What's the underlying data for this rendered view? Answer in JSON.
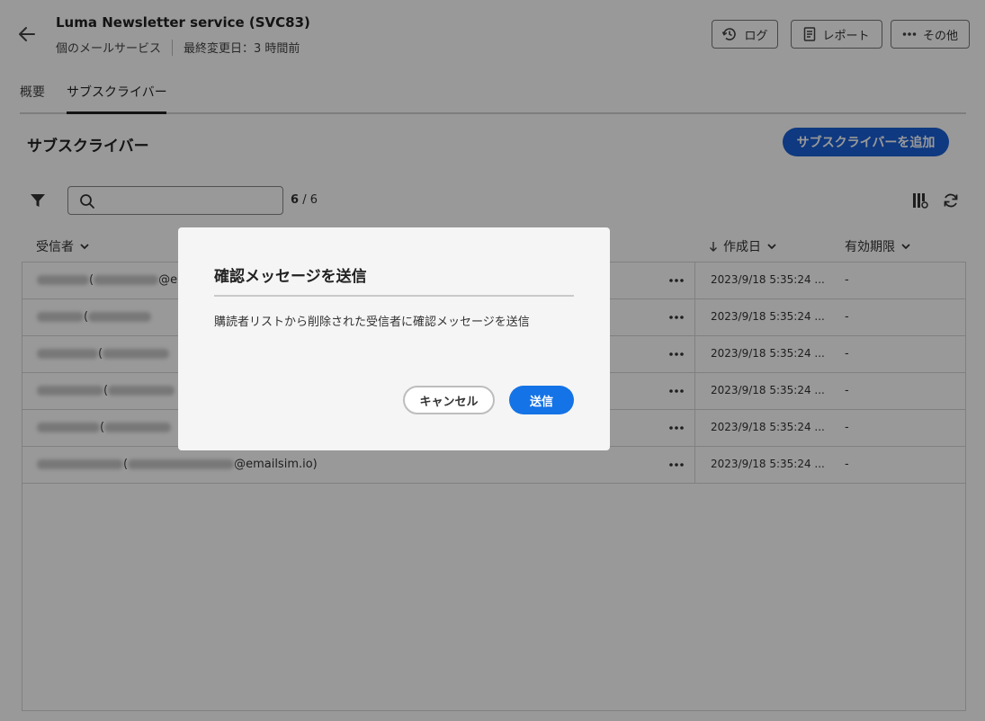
{
  "header": {
    "title": "Luma Newsletter service (SVC83)",
    "service_type": "個のメールサービス",
    "last_modified": "最終変更日：3 時間前",
    "log_label": "ログ",
    "report_label": "レポート",
    "more_label": "その他"
  },
  "tabs": [
    {
      "label": "概要"
    },
    {
      "label": "サブスクライバー"
    }
  ],
  "section": {
    "title": "サブスクライバー",
    "add_button": "サブスクライバーを追加"
  },
  "toolbar": {
    "search_placeholder": "",
    "count_shown": "6",
    "count_total": "6"
  },
  "table": {
    "columns": {
      "recipient": "受信者",
      "created": "作成日",
      "expiry": "有効期限"
    },
    "rows": [
      {
        "name_prefix": "(",
        "email_suffix": "@e",
        "created": "2023/9/18 5:35:24 ...",
        "expiry": "-"
      },
      {
        "name_prefix": "(",
        "email_suffix": "",
        "created": "2023/9/18 5:35:24 ...",
        "expiry": "-"
      },
      {
        "name_prefix": "(",
        "email_suffix": "",
        "created": "2023/9/18 5:35:24 ...",
        "expiry": "-"
      },
      {
        "name_prefix": "(",
        "email_suffix": "",
        "created": "2023/9/18 5:35:24 ...",
        "expiry": "-"
      },
      {
        "name_prefix": "(",
        "email_suffix": "",
        "created": "2023/9/18 5:35:24 ...",
        "expiry": "-"
      },
      {
        "name_prefix": "(",
        "email_suffix": "@emailsim.io)",
        "created": "2023/9/18 5:35:24 ...",
        "expiry": "-"
      }
    ]
  },
  "dialog": {
    "title": "確認メッセージを送信",
    "body": "購読者リストから削除された受信者に確認メッセージを送信",
    "cancel_label": "キャンセル",
    "send_label": "送信"
  },
  "colors": {
    "accent": "#1473e6",
    "overlay": "rgba(0,0,0,0.40)"
  }
}
